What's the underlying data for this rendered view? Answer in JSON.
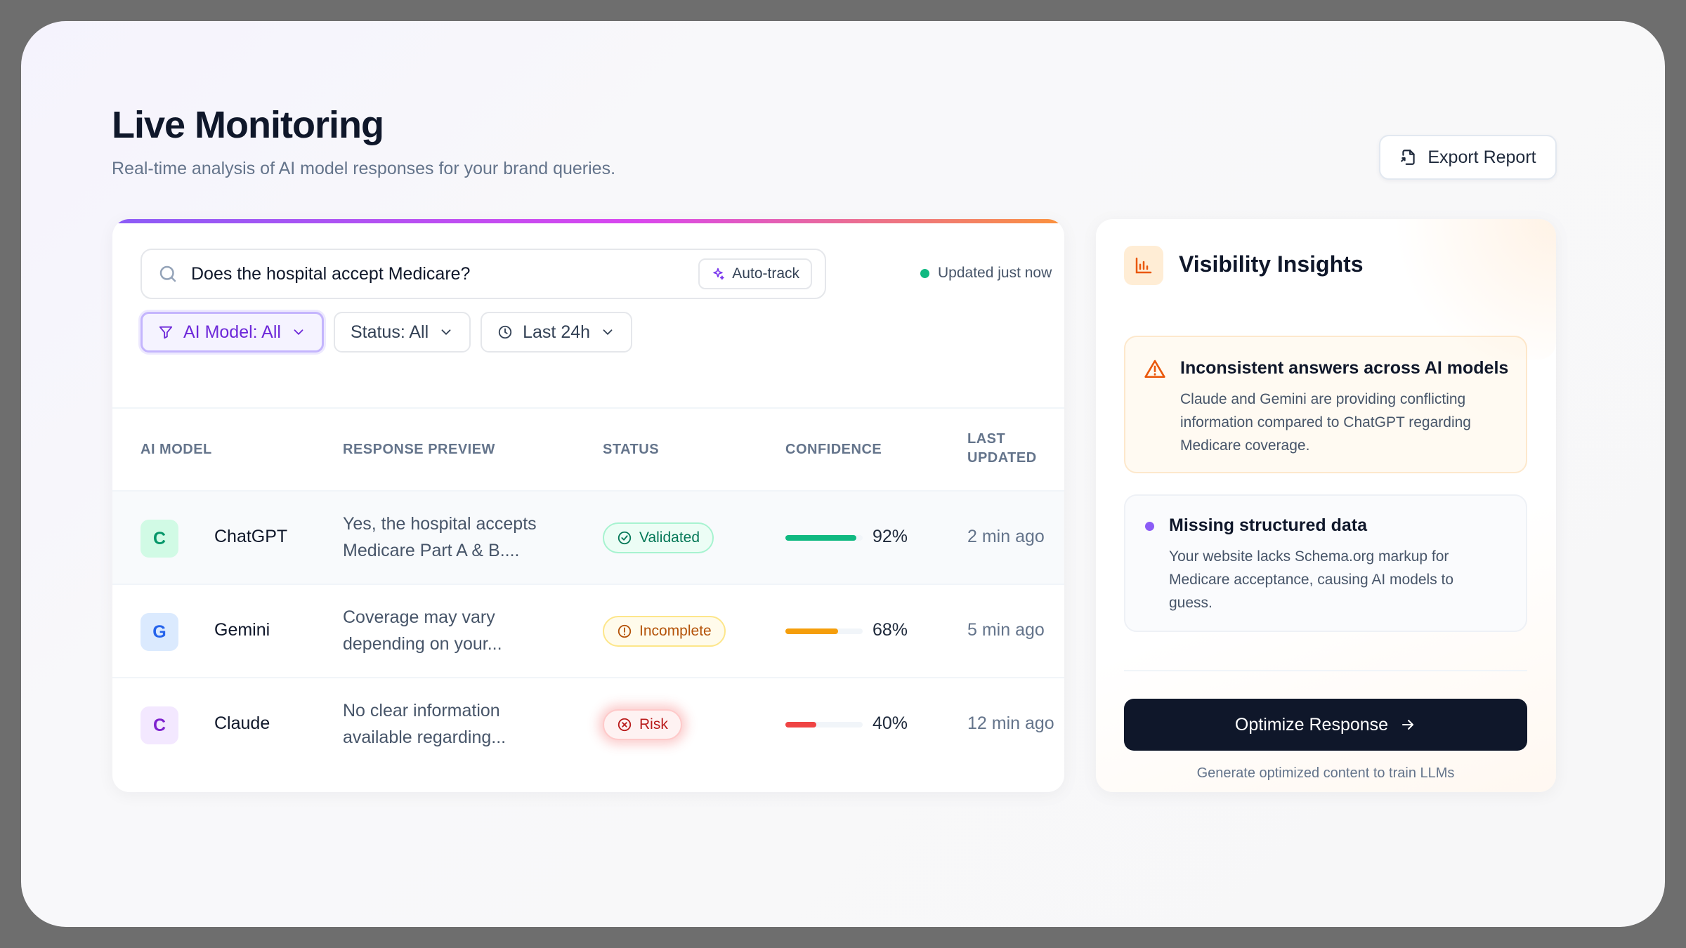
{
  "header": {
    "title": "Live Monitoring",
    "subtitle": "Real-time analysis of AI model responses for your brand queries.",
    "export_label": "Export Report"
  },
  "search": {
    "query": "Does the hospital accept Medicare?",
    "autotrack_label": "Auto-track",
    "updated_label": "Updated just now"
  },
  "filters": {
    "model": "AI Model: All",
    "status": "Status: All",
    "period": "Last 24h"
  },
  "table": {
    "headers": [
      "AI MODEL",
      "RESPONSE PREVIEW",
      "STATUS",
      "CONFIDENCE",
      "LAST UPDATED"
    ],
    "header_last_line1": "LAST",
    "header_last_line2": "UPDATED",
    "rows": [
      {
        "initial": "C",
        "model": "ChatGPT",
        "preview_line1": "Yes, the hospital accepts",
        "preview_line2": "Medicare Part A & B....",
        "status": "Validated",
        "confidence": 92,
        "confidence_label": "92%",
        "updated": "2 min ago",
        "color": "#10b981"
      },
      {
        "initial": "G",
        "model": "Gemini",
        "preview_line1": "Coverage may vary",
        "preview_line2": "depending on your...",
        "status": "Incomplete",
        "confidence": 68,
        "confidence_label": "68%",
        "updated": "5 min ago",
        "color": "#f59e0b"
      },
      {
        "initial": "C",
        "model": "Claude",
        "preview_line1": "No clear information",
        "preview_line2": "available regarding...",
        "status": "Risk",
        "confidence": 40,
        "confidence_label": "40%",
        "updated": "12 min ago",
        "color": "#ef4444"
      }
    ]
  },
  "insights": {
    "title": "Visibility Insights",
    "alerts": [
      {
        "title": "Inconsistent answers across AI models",
        "body_line1": "Claude and Gemini are providing conflicting",
        "body_line2": "information compared to ChatGPT regarding",
        "body_line3": "Medicare coverage."
      },
      {
        "title": "Missing structured data",
        "body_line1": "Your website lacks Schema.org markup for",
        "body_line2": "Medicare acceptance, causing AI models to",
        "body_line3": "guess."
      }
    ],
    "optimize_label": "Optimize Response",
    "optimize_hint": "Generate optimized content to train LLMs"
  },
  "icons": {
    "export": "export-file-icon",
    "search": "search-icon",
    "autotrack": "sparkle-icon",
    "filter": "funnel-icon",
    "clock": "clock-icon",
    "chevron": "chevron-down-icon",
    "validated": "check-circle-icon",
    "incomplete": "alert-circle-icon",
    "risk": "x-circle-icon",
    "insights": "bar-chart-icon",
    "warning": "warning-triangle-icon",
    "arrow": "arrow-right-icon"
  },
  "colors": {
    "accent": "#7c3aed",
    "dark_button": "#0f172a",
    "validated": "#10b981",
    "incomplete": "#f59e0b",
    "risk": "#ef4444"
  }
}
